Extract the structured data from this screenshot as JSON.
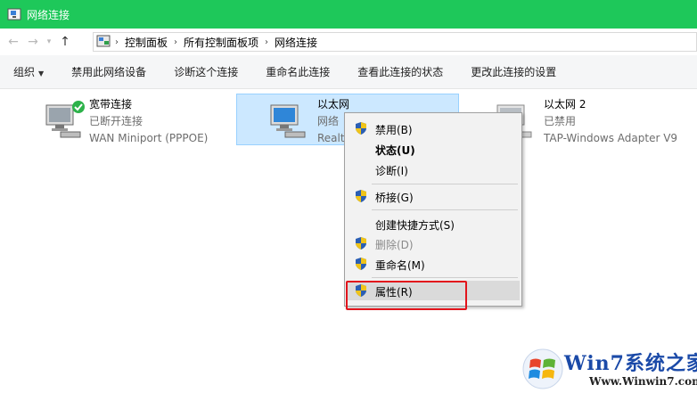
{
  "window": {
    "title": "网络连接"
  },
  "address": {
    "breadcrumbs": [
      "控制面板",
      "所有控制面板项",
      "网络连接"
    ]
  },
  "toolbar": {
    "items": [
      "组织",
      "禁用此网络设备",
      "诊断这个连接",
      "重命名此连接",
      "查看此连接的状态",
      "更改此连接的设置"
    ]
  },
  "connections": [
    {
      "name": "宽带连接",
      "status": "已断开连接",
      "device": "WAN Miniport (PPPOE)"
    },
    {
      "name": "以太网",
      "status": "网络",
      "device": "Realt"
    },
    {
      "name": "以太网 2",
      "status": "已禁用",
      "device": "TAP-Windows Adapter V9"
    }
  ],
  "context_menu": {
    "items": [
      {
        "label": "禁用(B)",
        "shield": true,
        "bold": false,
        "disabled": false
      },
      {
        "label": "状态(U)",
        "shield": false,
        "bold": true,
        "disabled": false
      },
      {
        "label": "诊断(I)",
        "shield": false,
        "bold": false,
        "disabled": false
      },
      {
        "label": "桥接(G)",
        "shield": true,
        "bold": false,
        "disabled": false
      },
      {
        "label": "创建快捷方式(S)",
        "shield": false,
        "bold": false,
        "disabled": false
      },
      {
        "label": "删除(D)",
        "shield": true,
        "bold": false,
        "disabled": true
      },
      {
        "label": "重命名(M)",
        "shield": true,
        "bold": false,
        "disabled": false
      },
      {
        "label": "属性(R)",
        "shield": true,
        "bold": false,
        "disabled": false,
        "highlighted": true
      }
    ]
  },
  "watermark": {
    "brand": "Win7系统之家",
    "url": "Www.Winwin7.com"
  },
  "colors": {
    "titlebar": "#1ec85a",
    "selection": "#cce8ff",
    "annotation": "#e2141c"
  }
}
